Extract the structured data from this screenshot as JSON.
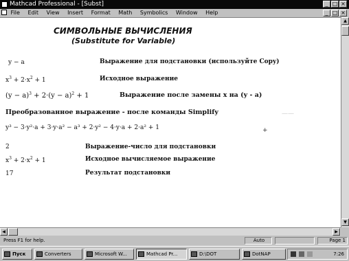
{
  "window": {
    "title": "Mathcad Professional - [Subst]"
  },
  "menu": {
    "items": [
      "File",
      "Edit",
      "View",
      "Insert",
      "Format",
      "Math",
      "Symbolics",
      "Window",
      "Help"
    ]
  },
  "worksheet": {
    "heading_line1": "СИМВОЛЬНЫЕ ВЫЧИСЛЕНИЯ",
    "heading_line2": "(Substitute for Variable)",
    "row1_math": "y − a",
    "row1_desc": "Выражение для подстановки (используйте Copy)",
    "row2_math_a": "x",
    "row2_math_b": " + 2·x",
    "row2_math_c": " + 1",
    "row2_desc": "Исходное выражение",
    "row3_math_a": "(y − a)",
    "row3_math_b": " + 2·(y − a)",
    "row3_math_c": " + 1",
    "row3_desc": "Выражение после замены x на (y - a)",
    "row4_text": "Преобразованное выражение - после команды Simplify",
    "row5_math": "y³ − 3·y²·a + 3·y·a² − a³ + 2·y² − 4·y·a + 2·a² + 1",
    "row6_math": "2",
    "row6_desc": "Выражение-число для подстановки",
    "row7_math_a": "x",
    "row7_math_b": " + 2·x",
    "row7_math_c": " + 1",
    "row7_desc": "Исходное вычисляемое выражение",
    "row8_math": "17",
    "row8_desc": "Результат подстановки",
    "exp3": "3",
    "exp2": "2"
  },
  "statusbar": {
    "help": "Press F1 for help.",
    "mode": "Auto",
    "page": "Page 1"
  },
  "taskbar": {
    "start": "Пуск",
    "tasks": [
      "Converters",
      "Microsoft W...",
      "Mathcad Pr...",
      "D:\\DOT",
      "DotNAP"
    ],
    "clock": "7:26"
  }
}
